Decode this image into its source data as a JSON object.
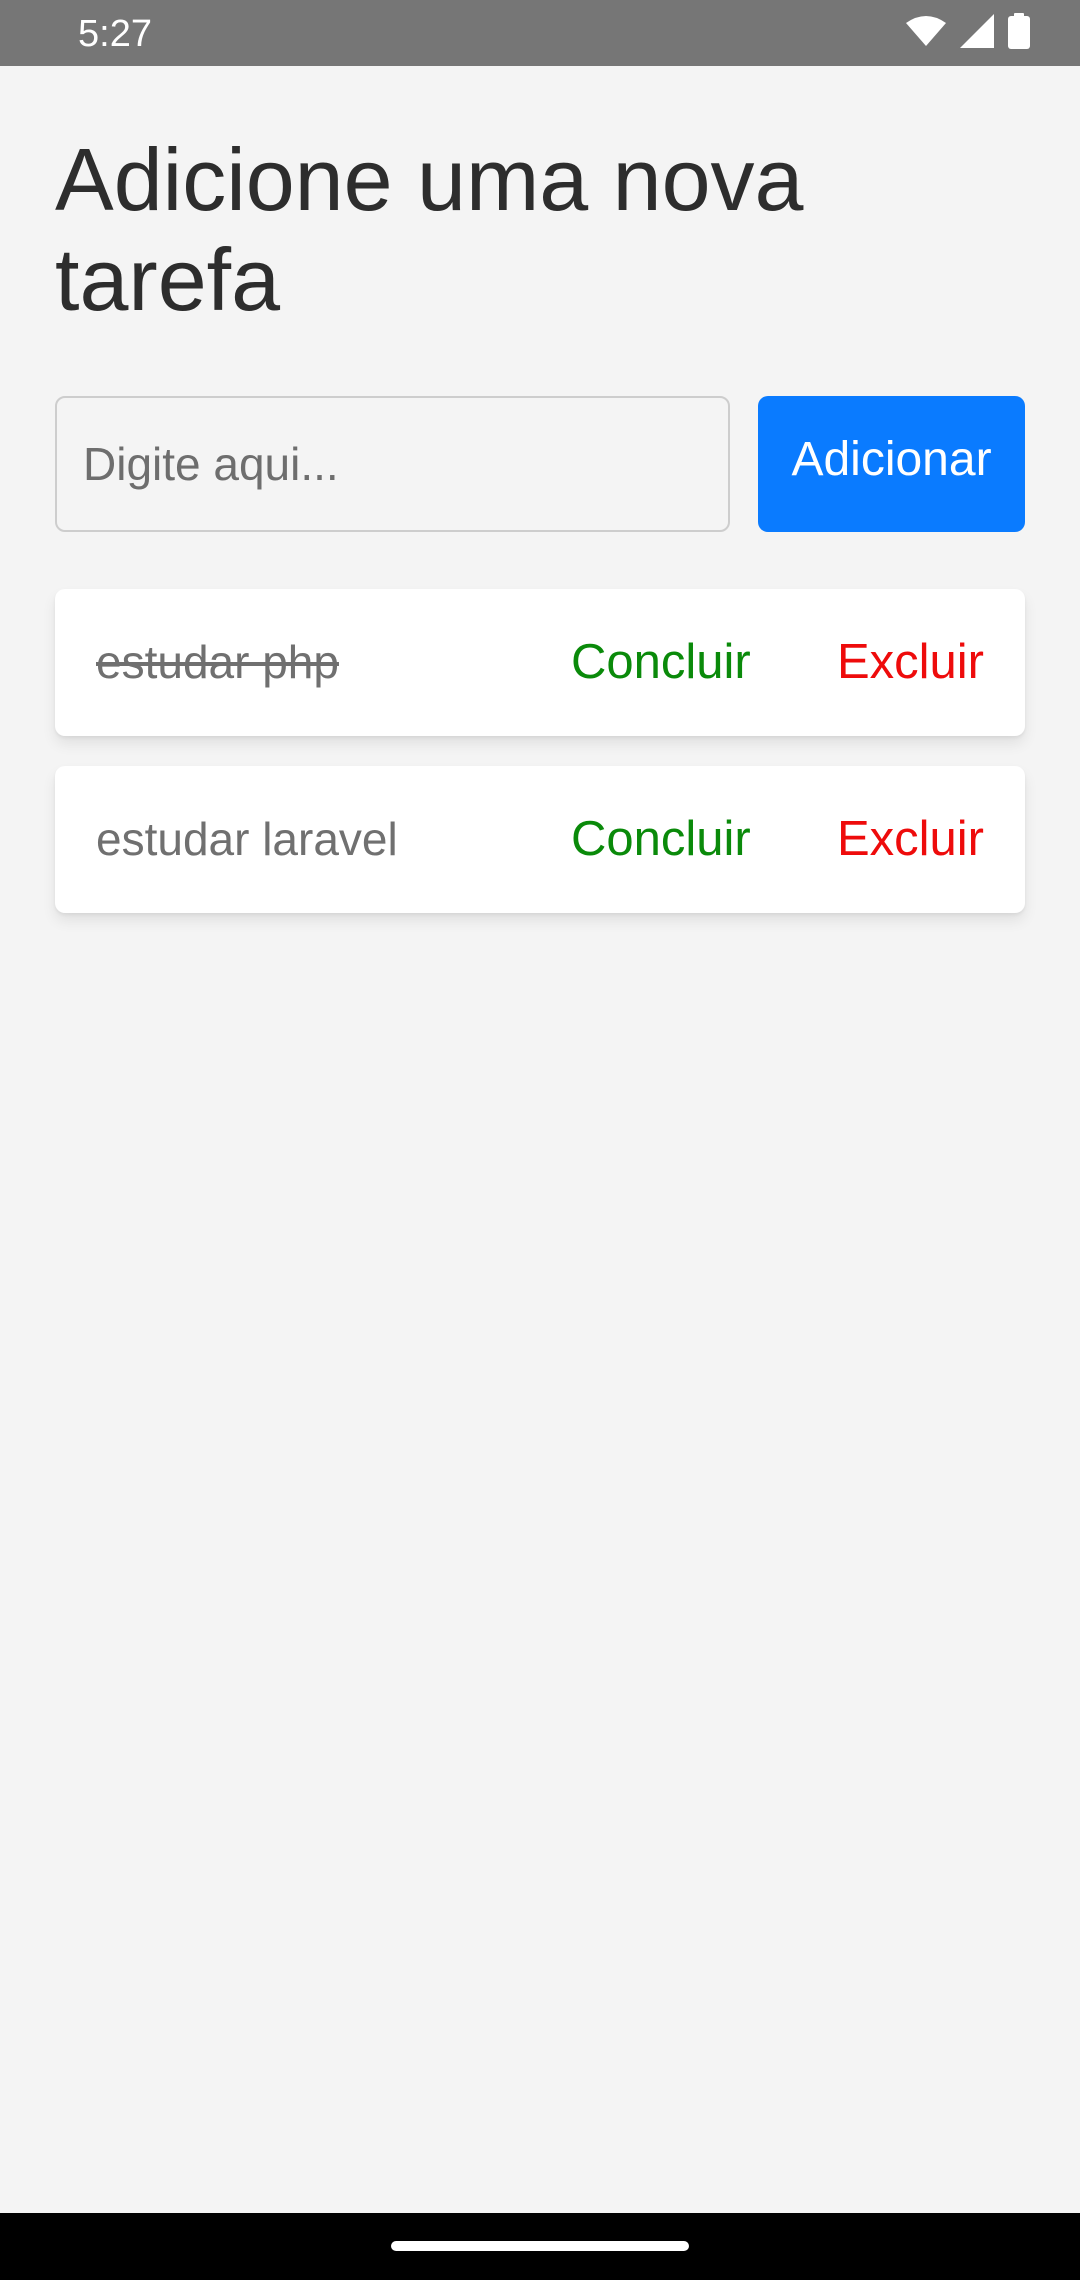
{
  "status_bar": {
    "time": "5:27",
    "icons": [
      "wifi-icon",
      "signal-icon",
      "battery-icon"
    ]
  },
  "page": {
    "title": "Adicione uma nova tarefa"
  },
  "new_task": {
    "value": "",
    "placeholder": "Digite aqui...",
    "add_label": "Adicionar"
  },
  "tasks": [
    {
      "text": "estudar php",
      "completed": true,
      "conclude_label": "Concluir",
      "delete_label": "Excluir"
    },
    {
      "text": "estudar laravel",
      "completed": false,
      "conclude_label": "Concluir",
      "delete_label": "Excluir"
    }
  ],
  "colors": {
    "accent": "#0a7bff",
    "conclude": "#0a8a0a",
    "delete": "#ee0b0b",
    "background": "#f4f4f4"
  }
}
